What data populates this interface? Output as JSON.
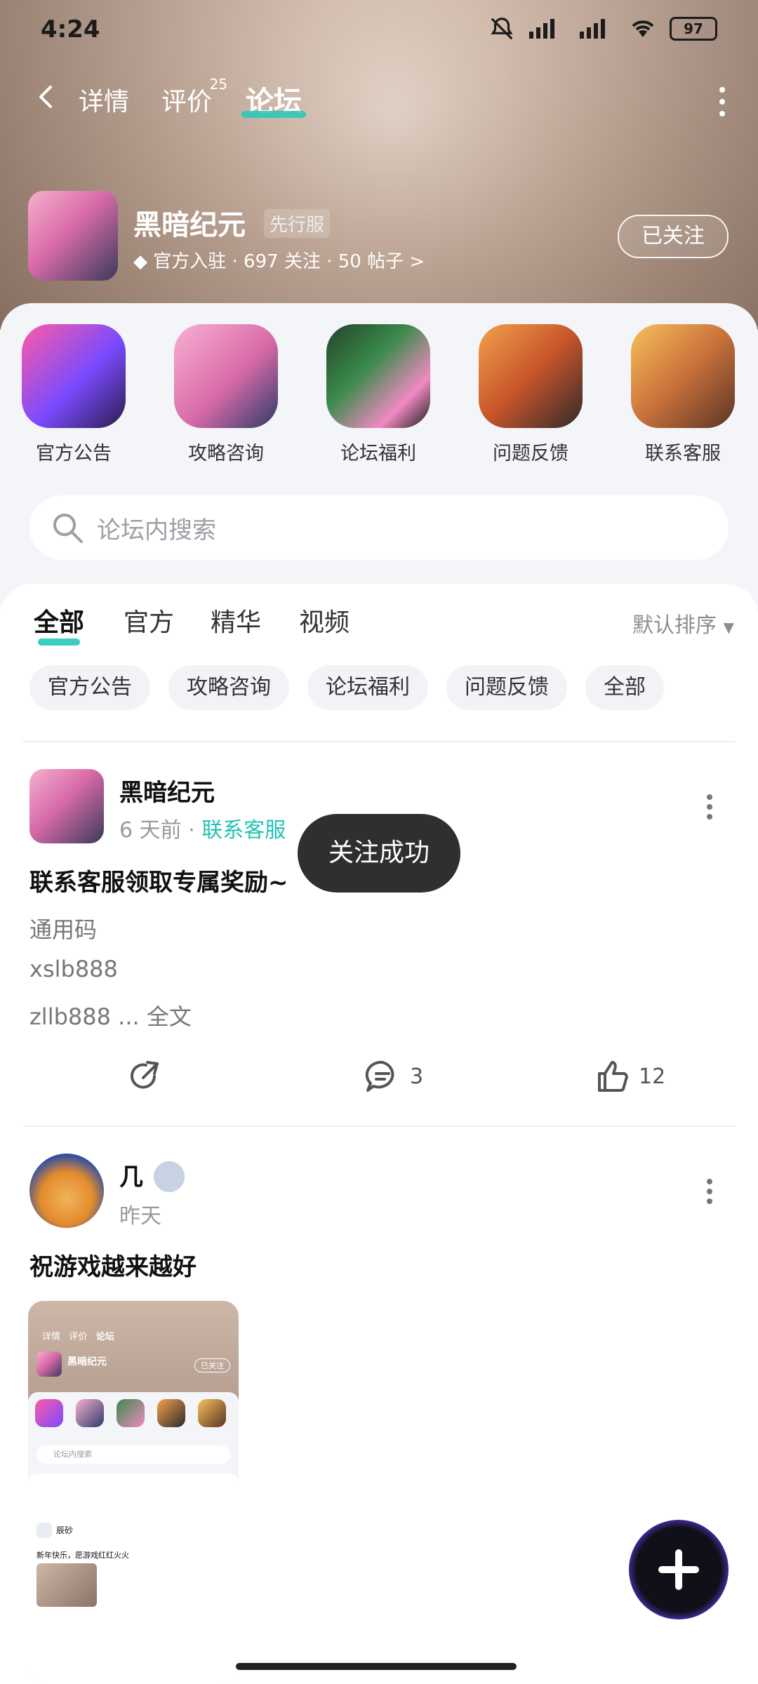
{
  "status": {
    "time": "4:24",
    "battery": "97"
  },
  "nav": {
    "tabs": [
      "详情",
      "评价",
      "论坛"
    ],
    "review_count": "25"
  },
  "game": {
    "name": "黑暗纪元",
    "tag": "先行服",
    "meta": "官方入驻 · 697 关注 · 50 帖子 >",
    "follow_label": "已关注"
  },
  "shortcuts": [
    "官方公告",
    "攻略咨询",
    "论坛福利",
    "问题反馈",
    "联系客服"
  ],
  "search": {
    "placeholder": "论坛内搜索"
  },
  "filter_tabs": [
    "全部",
    "官方",
    "精华",
    "视频"
  ],
  "sort_label": "默认排序",
  "chips": [
    "官方公告",
    "攻略咨询",
    "论坛福利",
    "问题反馈",
    "全部"
  ],
  "posts": [
    {
      "author": "黑暗纪元",
      "time": "6 天前",
      "section": "联系客服",
      "title": "联系客服领取专属奖励~",
      "lines": [
        "通用码",
        "xslb888",
        "zllb888 ... 全文"
      ],
      "comments": "3",
      "likes": "12"
    },
    {
      "author": "几",
      "time": "昨天",
      "title": "祝游戏越来越好"
    }
  ],
  "toast": "关注成功",
  "thumb": {
    "nav": [
      "详情",
      "评价",
      "论坛"
    ],
    "game": "黑暗纪元",
    "follow": "已关注",
    "search": "论坛内搜索",
    "post_title": "新年快乐，愿游戏红红火火",
    "author": "辰砂"
  },
  "colors": {
    "accent": "#25c9b8",
    "link": "#22c3b6",
    "sheet": "#f3f5f8"
  }
}
